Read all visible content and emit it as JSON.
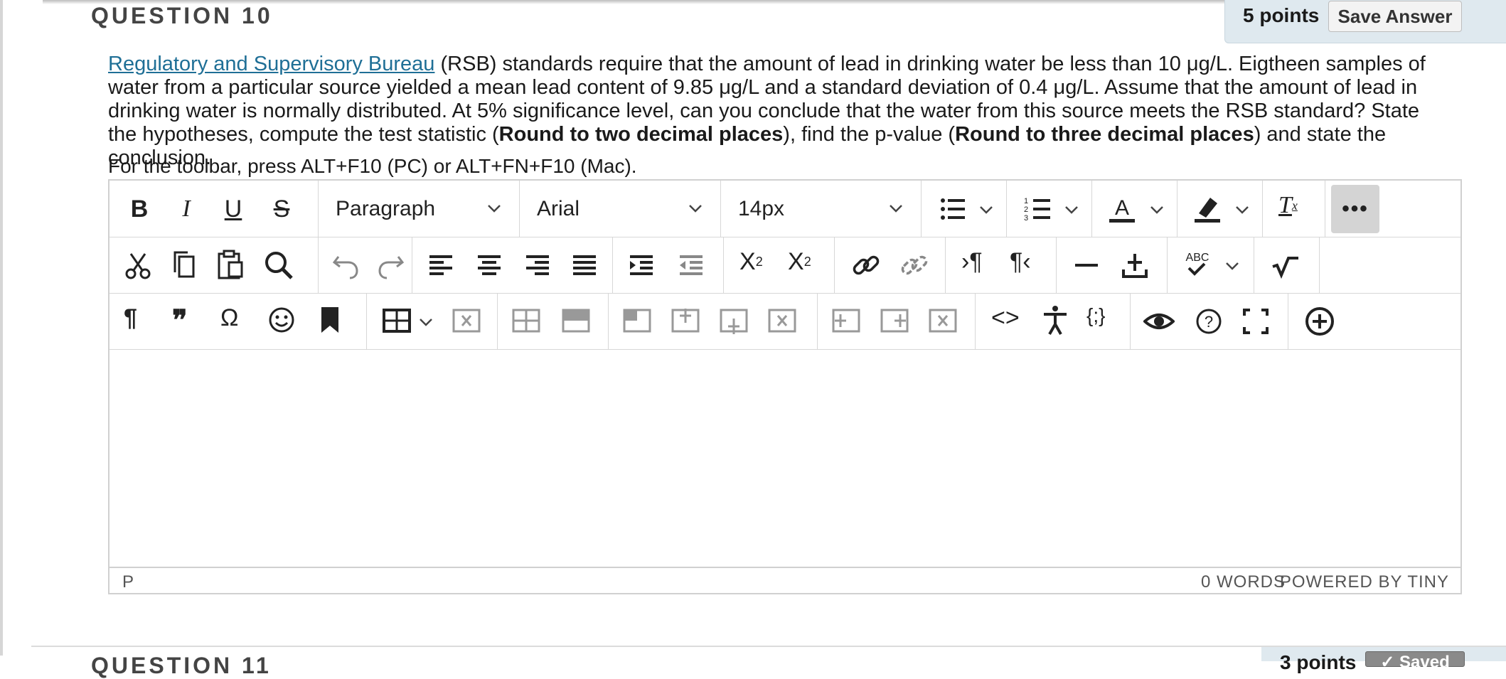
{
  "question": {
    "title": "QUESTION 10",
    "points": "5 points",
    "save_label": "Save Answer",
    "link_text": "Regulatory and Supervisory Bureau",
    "text_part1": " (RSB) standards require that the amount of lead in drinking water be less than 10 μg/L. Eigtheen samples of water from a particular source yielded a mean lead content of 9.85 μg/L and a standard deviation of 0.4 μg/L. Assume that the amount of lead in drinking water is normally distributed. At 5% significance level, can you conclude that the water from this source meets the RSB standard? State the hypotheses, compute the test statistic (",
    "bold1": "Round to two decimal places",
    "text_part2": "), find the p-value (",
    "bold2": "Round to three decimal places",
    "text_part3": ") and state the conclusion.",
    "toolbar_hint": "For the toolbar, press ALT+F10 (PC) or ALT+FN+F10 (Mac)."
  },
  "editor": {
    "block_format": "Paragraph",
    "font_family": "Arial",
    "font_size": "14px",
    "more_label": "•••",
    "status_path": "P",
    "word_count": "0 WORDS",
    "powered_by": "POWERED BY TINY",
    "icons": {
      "row1": [
        "bold-icon",
        "italic-icon",
        "underline-icon",
        "strikethrough-icon",
        "bullet-list-icon",
        "numbered-list-icon",
        "text-color-icon",
        "highlight-icon",
        "clear-formatting-icon",
        "more-icon"
      ],
      "row2": [
        "cut-icon",
        "copy-icon",
        "paste-icon",
        "find-icon",
        "undo-icon",
        "redo-icon",
        "align-left-icon",
        "align-center-icon",
        "align-right-icon",
        "justify-icon",
        "indent-icon",
        "outdent-icon",
        "superscript-icon",
        "subscript-icon",
        "link-icon",
        "unlink-icon",
        "ltr-icon",
        "rtl-icon",
        "horizontal-line-icon",
        "insert-anchor-icon",
        "spellcheck-icon",
        "math-icon"
      ],
      "row3": [
        "paragraph-mark-icon",
        "blockquote-icon",
        "special-char-icon",
        "emoji-icon",
        "bookmark-icon",
        "table-icon",
        "delete-table-icon",
        "table-row-props-icon",
        "table-cell-props-icon",
        "table-merge-icon",
        "insert-row-before-icon",
        "insert-row-after-icon",
        "delete-row-icon",
        "insert-column-before-icon",
        "insert-column-after-icon",
        "delete-column-icon",
        "source-code-icon",
        "accessibility-icon",
        "code-sample-icon",
        "preview-icon",
        "help-icon",
        "fullscreen-icon",
        "add-content-icon"
      ]
    }
  },
  "next_question": {
    "title": "QUESTION 11",
    "points": "3 points",
    "status_label": "✓ Saved"
  }
}
